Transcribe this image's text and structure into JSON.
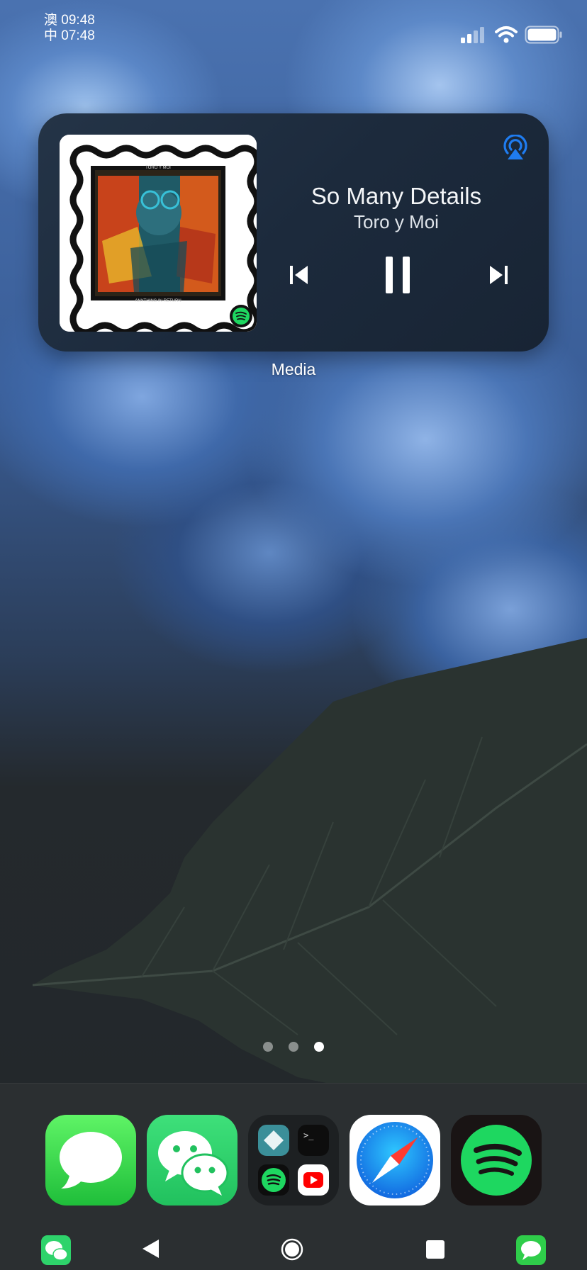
{
  "status_bar": {
    "time_line1": "澳 09:48",
    "time_line2": "中 07:48"
  },
  "media_widget": {
    "track_title": "So Many Details",
    "artist": "Toro y Moi",
    "label": "Media",
    "album_art_top_text": "TORO Y MOI",
    "album_art_bottom_text": "ANYTHING IN RETURN",
    "playback_state": "playing"
  },
  "page_indicator": {
    "total": 3,
    "active_index": 2
  },
  "dock": {
    "apps": [
      "messages",
      "wechat",
      "folder",
      "safari",
      "spotify"
    ]
  },
  "colors": {
    "messages_green": "#2fcd4a",
    "wechat_green": "#2ed36b",
    "spotify_green": "#1ed760",
    "airplay_blue": "#1f7cf0",
    "safari_blue": "#1a9bf0"
  }
}
